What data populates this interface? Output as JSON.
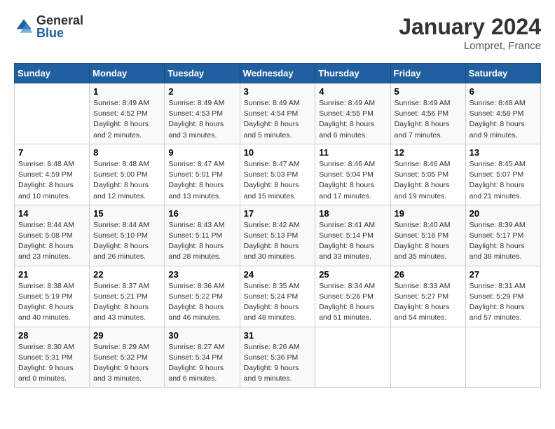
{
  "logo": {
    "general": "General",
    "blue": "Blue"
  },
  "header": {
    "month": "January 2024",
    "location": "Lompret, France"
  },
  "weekdays": [
    "Sunday",
    "Monday",
    "Tuesday",
    "Wednesday",
    "Thursday",
    "Friday",
    "Saturday"
  ],
  "weeks": [
    [
      {
        "day": "",
        "sunrise": "",
        "sunset": "",
        "daylight": ""
      },
      {
        "day": "1",
        "sunrise": "Sunrise: 8:49 AM",
        "sunset": "Sunset: 4:52 PM",
        "daylight": "Daylight: 8 hours and 2 minutes."
      },
      {
        "day": "2",
        "sunrise": "Sunrise: 8:49 AM",
        "sunset": "Sunset: 4:53 PM",
        "daylight": "Daylight: 8 hours and 3 minutes."
      },
      {
        "day": "3",
        "sunrise": "Sunrise: 8:49 AM",
        "sunset": "Sunset: 4:54 PM",
        "daylight": "Daylight: 8 hours and 5 minutes."
      },
      {
        "day": "4",
        "sunrise": "Sunrise: 8:49 AM",
        "sunset": "Sunset: 4:55 PM",
        "daylight": "Daylight: 8 hours and 6 minutes."
      },
      {
        "day": "5",
        "sunrise": "Sunrise: 8:49 AM",
        "sunset": "Sunset: 4:56 PM",
        "daylight": "Daylight: 8 hours and 7 minutes."
      },
      {
        "day": "6",
        "sunrise": "Sunrise: 8:48 AM",
        "sunset": "Sunset: 4:58 PM",
        "daylight": "Daylight: 8 hours and 9 minutes."
      }
    ],
    [
      {
        "day": "7",
        "sunrise": "Sunrise: 8:48 AM",
        "sunset": "Sunset: 4:59 PM",
        "daylight": "Daylight: 8 hours and 10 minutes."
      },
      {
        "day": "8",
        "sunrise": "Sunrise: 8:48 AM",
        "sunset": "Sunset: 5:00 PM",
        "daylight": "Daylight: 8 hours and 12 minutes."
      },
      {
        "day": "9",
        "sunrise": "Sunrise: 8:47 AM",
        "sunset": "Sunset: 5:01 PM",
        "daylight": "Daylight: 8 hours and 13 minutes."
      },
      {
        "day": "10",
        "sunrise": "Sunrise: 8:47 AM",
        "sunset": "Sunset: 5:03 PM",
        "daylight": "Daylight: 8 hours and 15 minutes."
      },
      {
        "day": "11",
        "sunrise": "Sunrise: 8:46 AM",
        "sunset": "Sunset: 5:04 PM",
        "daylight": "Daylight: 8 hours and 17 minutes."
      },
      {
        "day": "12",
        "sunrise": "Sunrise: 8:46 AM",
        "sunset": "Sunset: 5:05 PM",
        "daylight": "Daylight: 8 hours and 19 minutes."
      },
      {
        "day": "13",
        "sunrise": "Sunrise: 8:45 AM",
        "sunset": "Sunset: 5:07 PM",
        "daylight": "Daylight: 8 hours and 21 minutes."
      }
    ],
    [
      {
        "day": "14",
        "sunrise": "Sunrise: 8:44 AM",
        "sunset": "Sunset: 5:08 PM",
        "daylight": "Daylight: 8 hours and 23 minutes."
      },
      {
        "day": "15",
        "sunrise": "Sunrise: 8:44 AM",
        "sunset": "Sunset: 5:10 PM",
        "daylight": "Daylight: 8 hours and 26 minutes."
      },
      {
        "day": "16",
        "sunrise": "Sunrise: 8:43 AM",
        "sunset": "Sunset: 5:11 PM",
        "daylight": "Daylight: 8 hours and 28 minutes."
      },
      {
        "day": "17",
        "sunrise": "Sunrise: 8:42 AM",
        "sunset": "Sunset: 5:13 PM",
        "daylight": "Daylight: 8 hours and 30 minutes."
      },
      {
        "day": "18",
        "sunrise": "Sunrise: 8:41 AM",
        "sunset": "Sunset: 5:14 PM",
        "daylight": "Daylight: 8 hours and 33 minutes."
      },
      {
        "day": "19",
        "sunrise": "Sunrise: 8:40 AM",
        "sunset": "Sunset: 5:16 PM",
        "daylight": "Daylight: 8 hours and 35 minutes."
      },
      {
        "day": "20",
        "sunrise": "Sunrise: 8:39 AM",
        "sunset": "Sunset: 5:17 PM",
        "daylight": "Daylight: 8 hours and 38 minutes."
      }
    ],
    [
      {
        "day": "21",
        "sunrise": "Sunrise: 8:38 AM",
        "sunset": "Sunset: 5:19 PM",
        "daylight": "Daylight: 8 hours and 40 minutes."
      },
      {
        "day": "22",
        "sunrise": "Sunrise: 8:37 AM",
        "sunset": "Sunset: 5:21 PM",
        "daylight": "Daylight: 8 hours and 43 minutes."
      },
      {
        "day": "23",
        "sunrise": "Sunrise: 8:36 AM",
        "sunset": "Sunset: 5:22 PM",
        "daylight": "Daylight: 8 hours and 46 minutes."
      },
      {
        "day": "24",
        "sunrise": "Sunrise: 8:35 AM",
        "sunset": "Sunset: 5:24 PM",
        "daylight": "Daylight: 8 hours and 48 minutes."
      },
      {
        "day": "25",
        "sunrise": "Sunrise: 8:34 AM",
        "sunset": "Sunset: 5:26 PM",
        "daylight": "Daylight: 8 hours and 51 minutes."
      },
      {
        "day": "26",
        "sunrise": "Sunrise: 8:33 AM",
        "sunset": "Sunset: 5:27 PM",
        "daylight": "Daylight: 8 hours and 54 minutes."
      },
      {
        "day": "27",
        "sunrise": "Sunrise: 8:31 AM",
        "sunset": "Sunset: 5:29 PM",
        "daylight": "Daylight: 8 hours and 57 minutes."
      }
    ],
    [
      {
        "day": "28",
        "sunrise": "Sunrise: 8:30 AM",
        "sunset": "Sunset: 5:31 PM",
        "daylight": "Daylight: 9 hours and 0 minutes."
      },
      {
        "day": "29",
        "sunrise": "Sunrise: 8:29 AM",
        "sunset": "Sunset: 5:32 PM",
        "daylight": "Daylight: 9 hours and 3 minutes."
      },
      {
        "day": "30",
        "sunrise": "Sunrise: 8:27 AM",
        "sunset": "Sunset: 5:34 PM",
        "daylight": "Daylight: 9 hours and 6 minutes."
      },
      {
        "day": "31",
        "sunrise": "Sunrise: 8:26 AM",
        "sunset": "Sunset: 5:36 PM",
        "daylight": "Daylight: 9 hours and 9 minutes."
      },
      {
        "day": "",
        "sunrise": "",
        "sunset": "",
        "daylight": ""
      },
      {
        "day": "",
        "sunrise": "",
        "sunset": "",
        "daylight": ""
      },
      {
        "day": "",
        "sunrise": "",
        "sunset": "",
        "daylight": ""
      }
    ]
  ]
}
